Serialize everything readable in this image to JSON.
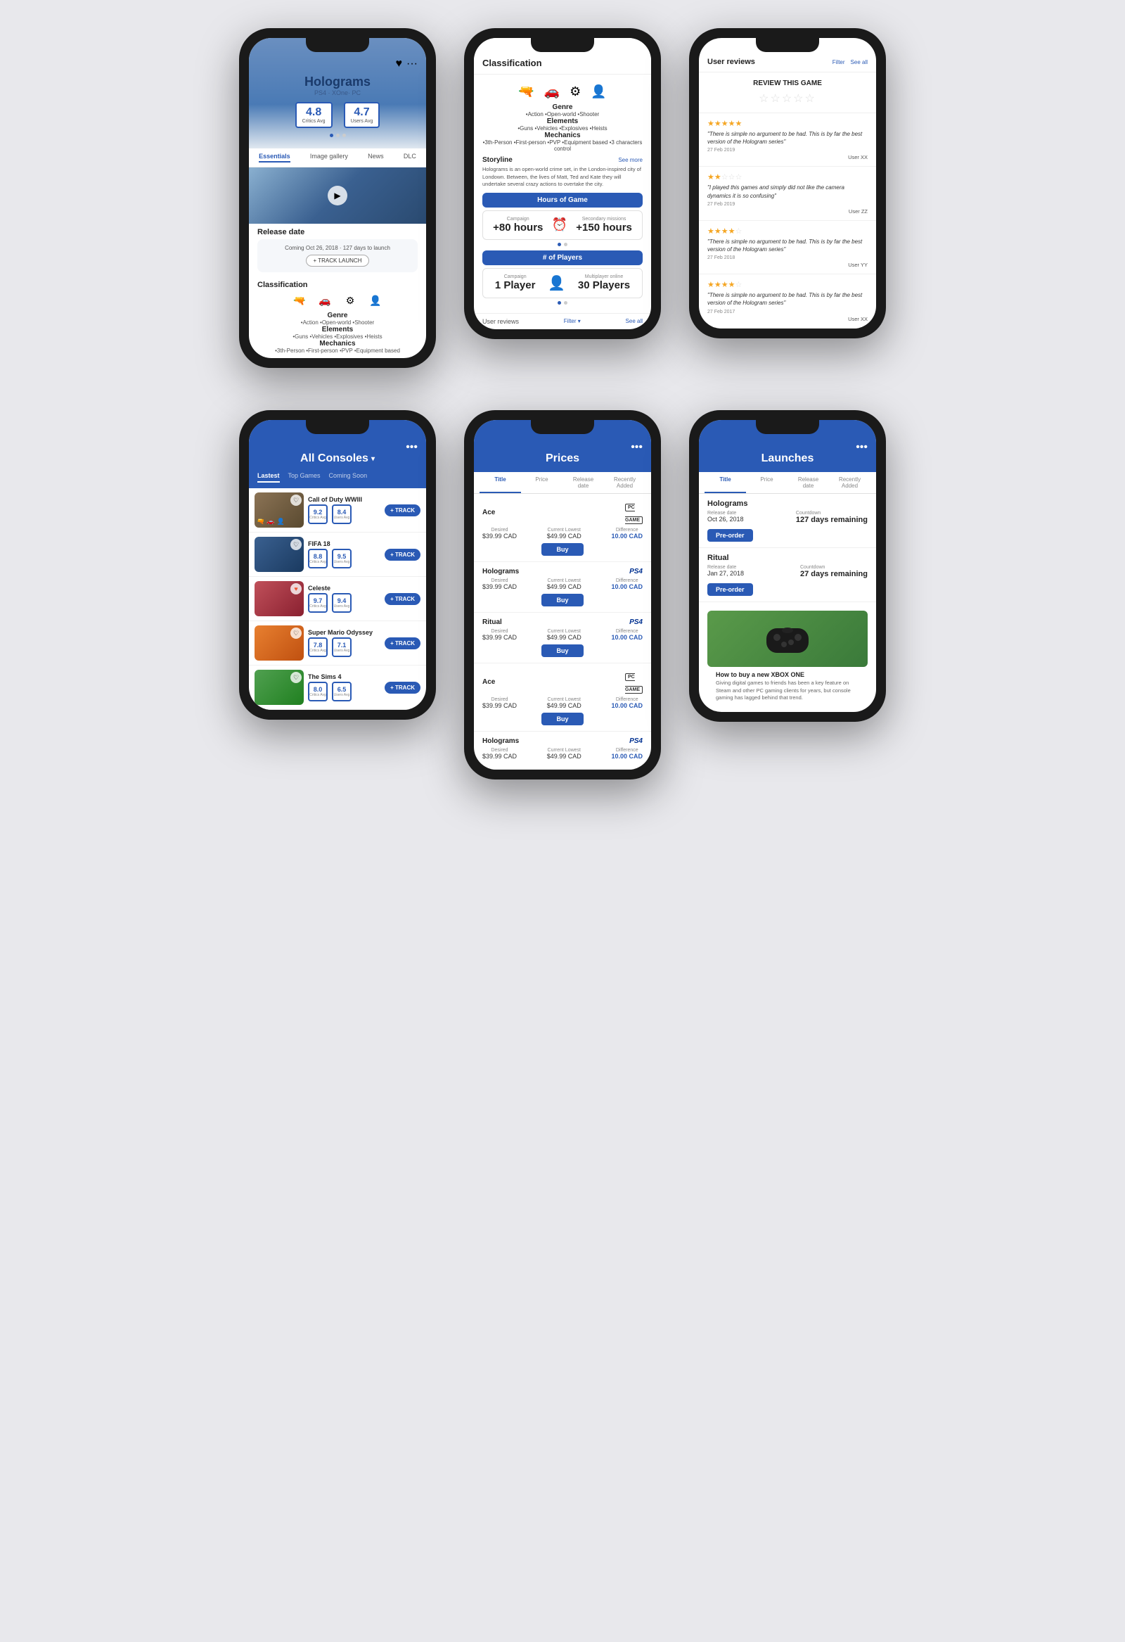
{
  "phone1": {
    "title": "Holograms",
    "subtitle": "PS4 · XOne· PC",
    "critics_avg": "4.8",
    "users_avg": "4.7",
    "critics_label": "Critics Avg",
    "users_label": "Users Avg",
    "nav_items": [
      "Essentials",
      "Image gallery",
      "News",
      "DLC"
    ],
    "active_nav": "Essentials",
    "release_section": "Release date",
    "release_text": "Coming Oct 26, 2018 · 127 days to launch",
    "track_btn": "+ TRACK LAUNCH",
    "classification_section": "Classification",
    "genre_title": "Genre",
    "genre_items": "•Action •Open-world •Shooter",
    "elements_title": "Elements",
    "elements_items": "•Guns •Vehicles •Explosives •Heists",
    "mechanics_title": "Mechanics",
    "mechanics_items": "•3th-Person •First-person •PVP •Equipment based",
    "heart_icon": "♥",
    "dots_icon": "···"
  },
  "phone2": {
    "header": "Classification",
    "genre_title": "Genre",
    "genre_items": "•Action •Open-world •Shooter",
    "elements_title": "Elements",
    "elements_items": "•Guns •Vehicles •Explosives •Heists",
    "mechanics_title": "Mechanics",
    "mechanics_items": "•3th-Person •First-person •PVP •Equipment based •3 characters control",
    "storyline_title": "Storyline",
    "see_more": "See more",
    "storyline_text": "Holograms is an open-world crime set, in the London-inspired city of Londown. Between, the lives of Matt, Ted and Kate they will undertake several crazy actions to overtake the city.",
    "hours_header": "Hours of Game",
    "campaign_label": "Campaign",
    "campaign_value": "+80 hours",
    "secondary_label": "Secondary missions",
    "secondary_value": "+150 hours",
    "players_header": "# of Players",
    "players_campaign_label": "Campaign",
    "players_campaign_value": "1 Player",
    "players_multiplayer_label": "Multiplayer online",
    "players_multiplayer_value": "30 Players",
    "user_reviews": "User reviews",
    "filter": "Filter",
    "see_all": "See all"
  },
  "phone3": {
    "header": "User reviews",
    "filter": "Filter",
    "see_all": "See all",
    "review_cta": "REVIEW THIS GAME",
    "reviews": [
      {
        "stars": 5,
        "text": "\"There is simple no argument to be had. This is by far the best version of the Hologram series\"",
        "date": "27 Feb 2019",
        "user": "User XX"
      },
      {
        "stars": 2,
        "text": "\"I played this games and simply did not like the camera dynamics it is so confusing\"",
        "date": "27 Feb 2019",
        "user": "User ZZ"
      },
      {
        "stars": 4,
        "text": "\"There is simple no argument to be had. This is by far the best version of the Hologram series\"",
        "date": "27 Feb 2018",
        "user": "User YY"
      },
      {
        "stars": 4,
        "text": "\"There is simple no argument to be had. This is by far the best version of the Hologram series\"",
        "date": "27 Feb 2017",
        "user": "User XX"
      }
    ]
  },
  "phone4": {
    "header": "All Consoles",
    "tabs": [
      "Lastest",
      "Top Games",
      "Coming Soon"
    ],
    "active_tab": "Lastest",
    "games": [
      {
        "name": "Call of Duty WWIII",
        "critics": "9.2",
        "users": "8.4",
        "track": "+ TRACK",
        "color": "cod"
      },
      {
        "name": "FIFA 18",
        "critics": "8.8",
        "users": "9.5",
        "track": "+ TRACK",
        "color": "fifa"
      },
      {
        "name": "Celeste",
        "critics": "9.7",
        "users": "9.4",
        "track": "+ TRACK",
        "color": "celeste"
      },
      {
        "name": "Super Mario Odyssey",
        "critics": "7.8",
        "users": "7.1",
        "track": "+ TRACK",
        "color": "mario"
      },
      {
        "name": "The Sims 4",
        "critics": "8.0",
        "users": "6.5",
        "track": "+ TRACK",
        "color": "sims"
      }
    ]
  },
  "phone5": {
    "header": "Prices",
    "tabs": [
      "Title",
      "Price",
      "Release date",
      "Recently Added"
    ],
    "active_tab": "Title",
    "prices": [
      {
        "name": "Ace",
        "platform": "PC",
        "platform_type": "pc",
        "desired_label": "Desired",
        "desired": "$39.99 CAD",
        "current_label": "Current Lowest",
        "current": "$49.99 CAD",
        "diff_label": "Difference",
        "diff": "10.00 CAD",
        "buy": "Buy"
      },
      {
        "name": "Holograms",
        "platform": "PS4",
        "platform_type": "ps4",
        "desired_label": "Desired",
        "desired": "$39.99 CAD",
        "current_label": "Current Lowest",
        "current": "$49.99 CAD",
        "diff_label": "Difference",
        "diff": "10.00 CAD",
        "buy": "Buy"
      },
      {
        "name": "Ritual",
        "platform": "PS4",
        "platform_type": "ps4",
        "desired_label": "Desired",
        "desired": "$39.99 CAD",
        "current_label": "Current Lowest",
        "current": "$49.99 CAD",
        "diff_label": "Difference",
        "diff": "10.00 CAD",
        "buy": "Buy"
      },
      {
        "name": "Ace",
        "platform": "PC",
        "platform_type": "pc",
        "desired_label": "Desired",
        "desired": "$39.99 CAD",
        "current_label": "Current Lowest",
        "current": "$49.99 CAD",
        "diff_label": "Difference",
        "diff": "10.00 CAD",
        "buy": "Buy"
      },
      {
        "name": "Holograms",
        "platform": "PS4",
        "platform_type": "ps4",
        "desired_label": "Desired",
        "desired": "$39.99 CAD",
        "current_label": "Current Lowest",
        "current": "$49.99 CAD",
        "diff_label": "Difference",
        "diff": "10.00 CAD",
        "buy": "Buy"
      }
    ]
  },
  "phone6": {
    "header": "Launches",
    "tabs": [
      "Title",
      "Price",
      "Release date",
      "Recently Added"
    ],
    "active_tab": "Title",
    "launches": [
      {
        "name": "Holograms",
        "release_label": "Release date",
        "release_date": "Oct 26, 2018",
        "countdown_label": "Countdown",
        "countdown": "127 days remaining",
        "btn": "Pre-order"
      },
      {
        "name": "Ritual",
        "release_label": "Release date",
        "release_date": "Jan 27, 2018",
        "countdown_label": "Countdown",
        "countdown": "27 days remaining",
        "btn": "Pre-order"
      }
    ],
    "news_title": "How to buy a new XBOX ONE",
    "news_text": "Giving digital games to friends has been a key feature on Steam and other PC gaming clients for years, but console gaming has lagged behind that trend."
  },
  "icons": {
    "heart": "♥",
    "dots": "•••",
    "star": "★",
    "star_empty": "☆",
    "gun": "🔫",
    "car": "🚗",
    "gear": "⚙",
    "person": "👤",
    "chevron_down": "▾",
    "play": "▶"
  }
}
